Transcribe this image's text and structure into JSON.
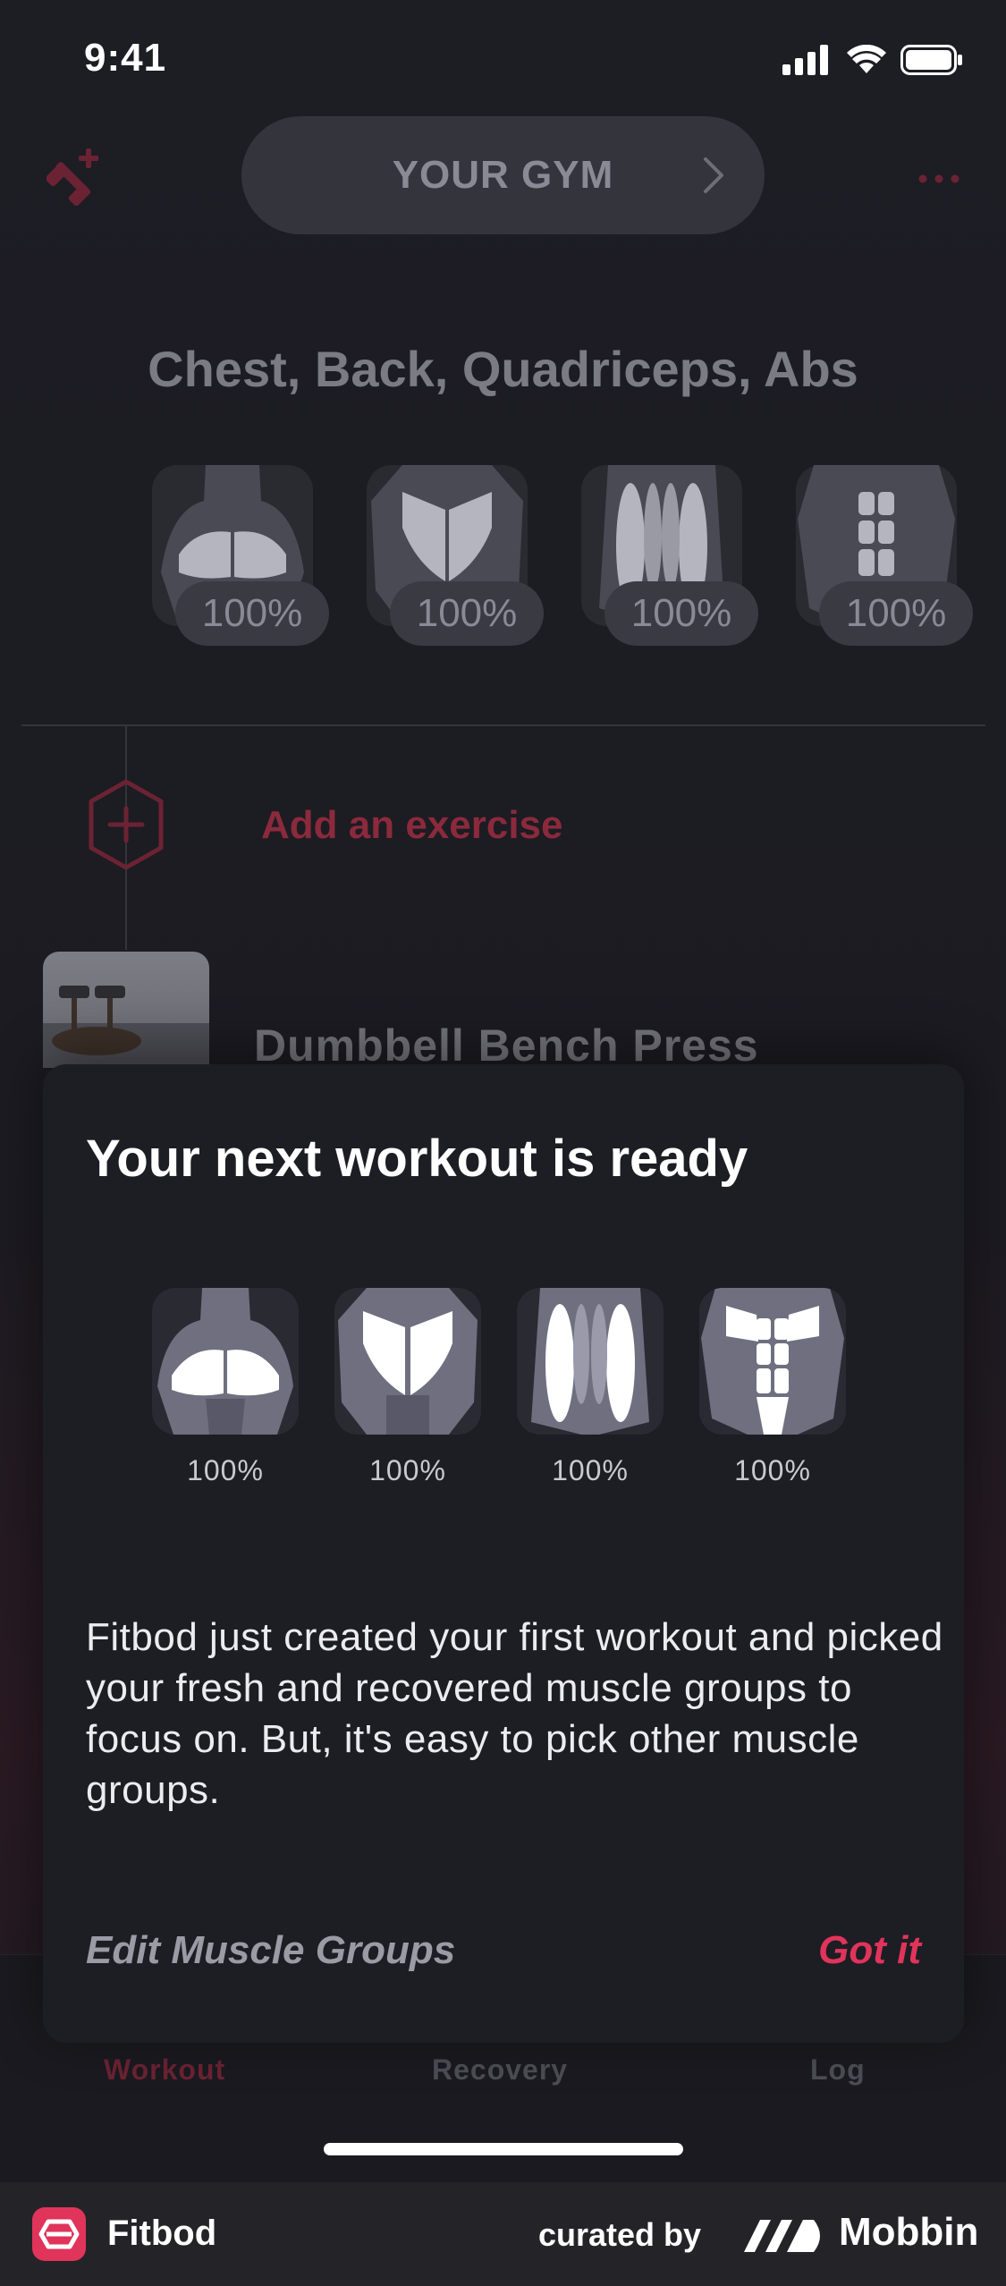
{
  "status_bar": {
    "time": "9:41"
  },
  "header": {
    "gym_label": "YOUR GYM"
  },
  "workout": {
    "muscle_title": "Chest, Back, Quadriceps, Abs",
    "muscles": [
      {
        "name": "chest",
        "percent": "100%"
      },
      {
        "name": "back",
        "percent": "100%"
      },
      {
        "name": "quadriceps",
        "percent": "100%"
      },
      {
        "name": "abs",
        "percent": "100%"
      }
    ],
    "add_exercise_label": "Add an exercise",
    "exercise_name": "Dumbbell Bench Press"
  },
  "modal": {
    "title": "Your next workout is ready",
    "muscles": [
      {
        "name": "chest",
        "percent": "100%"
      },
      {
        "name": "back",
        "percent": "100%"
      },
      {
        "name": "quadriceps",
        "percent": "100%"
      },
      {
        "name": "abs",
        "percent": "100%"
      }
    ],
    "description": "Fitbod just created your first workout and picked your fresh and recovered muscle groups to focus on. But, it's easy to pick other muscle groups.",
    "edit_label": "Edit Muscle Groups",
    "confirm_label": "Got it"
  },
  "tabs": [
    {
      "label": "Workout",
      "active": true
    },
    {
      "label": "Recovery",
      "active": false
    },
    {
      "label": "Log",
      "active": false
    }
  ],
  "footer": {
    "app_name": "Fitbod",
    "curated_by": "curated by",
    "brand": "Mobbin"
  },
  "colors": {
    "accent": "#e0345a",
    "accent_dim": "#8a2a3c",
    "background": "#1c1c22",
    "card": "#1d1d24"
  },
  "icons": [
    "dumbbell-plus-icon",
    "chevron-right-icon",
    "more-icon",
    "add-hexagon-icon",
    "signal-icon",
    "wifi-icon",
    "battery-icon"
  ]
}
